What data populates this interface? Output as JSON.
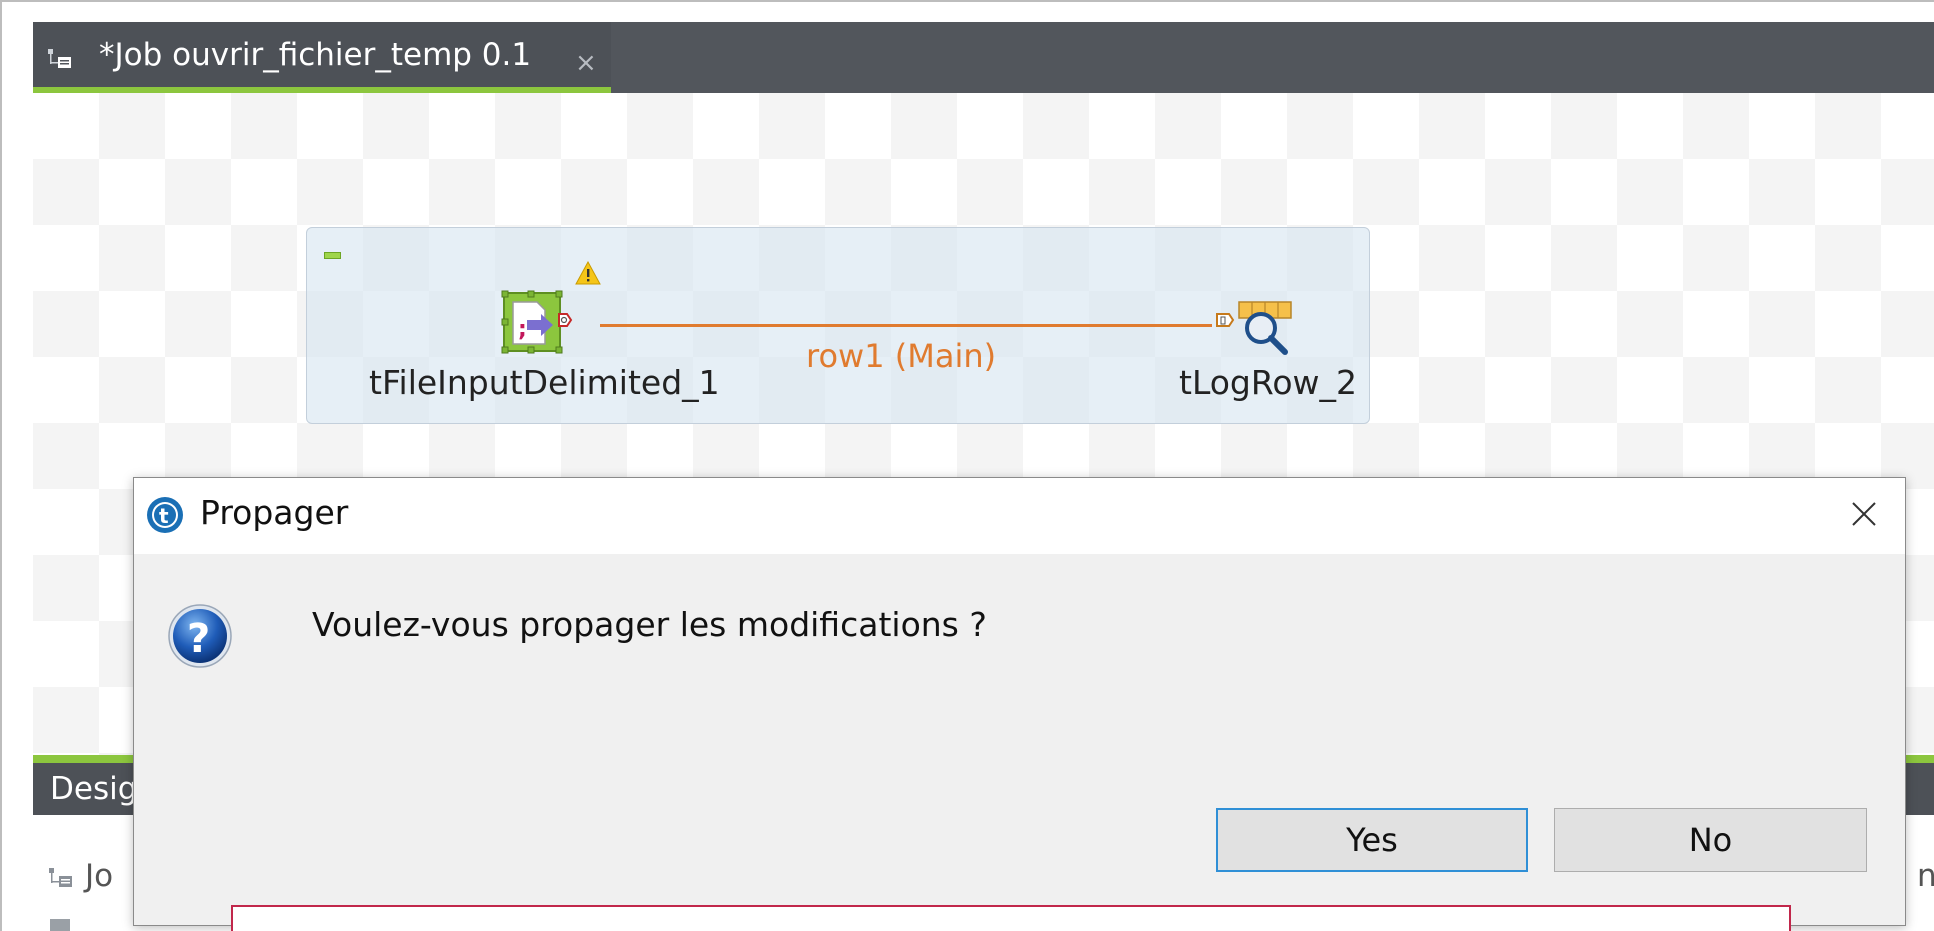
{
  "editor": {
    "tab_title": "*Job ouvrir_fichier_temp 0.1",
    "tab_close_glyph": "×",
    "tab_icon": "job-icon"
  },
  "designer": {
    "components": [
      {
        "label": "tFileInputDelimited_1",
        "icon": "file-input-delimited-icon",
        "warning_icon": "warning-icon"
      },
      {
        "label": "tLogRow_2",
        "icon": "log-row-icon"
      }
    ],
    "connection": {
      "label": "row1 (Main)",
      "color": "#e07b2f"
    },
    "subjob_color": "#d6e4f0",
    "accent_color": "#8cc63e"
  },
  "bottom_panel": {
    "tab_label_partial": "Desig",
    "job_text_partial": "Jo",
    "right_text_partial": "ni"
  },
  "dialog": {
    "title": "Propager",
    "app_icon": "talend-icon",
    "close_icon": "close-icon",
    "question_icon": "question-icon",
    "message": "Voulez-vous propager les modifications ?",
    "buttons": {
      "yes": "Yes",
      "no": "No"
    },
    "default_button_border": "#2f8fd6"
  },
  "annotation": {
    "highlight_color": "#c1274b"
  }
}
